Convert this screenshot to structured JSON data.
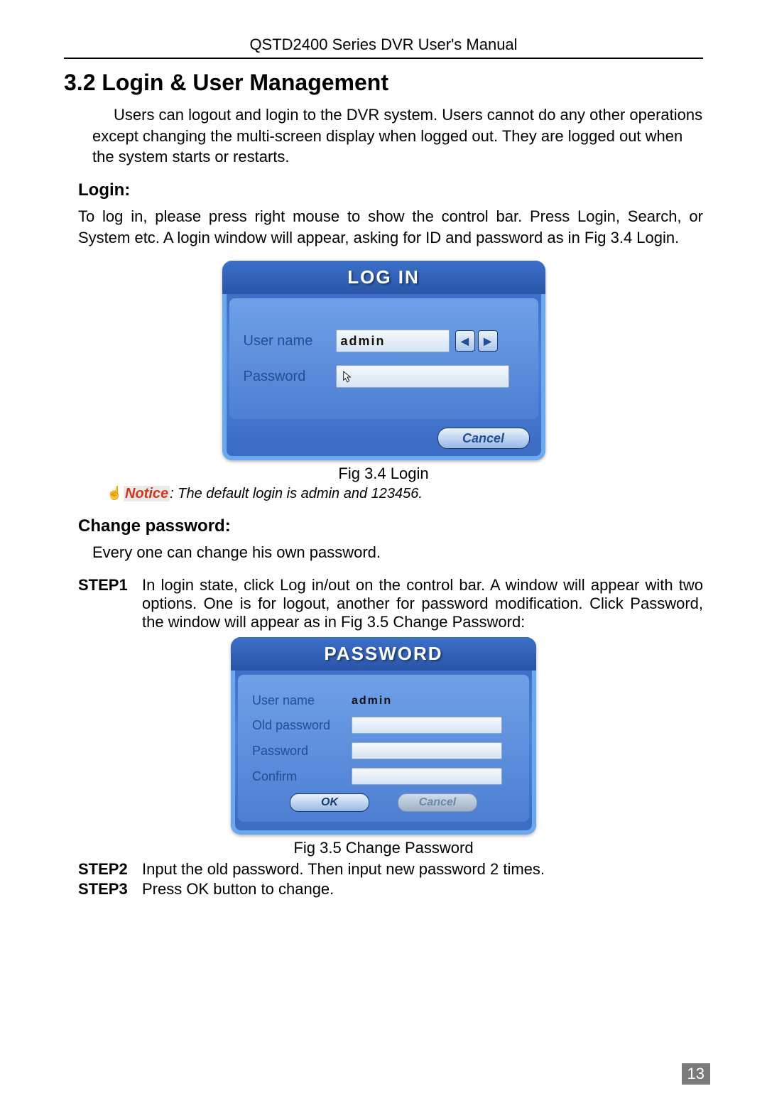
{
  "header": "QSTD2400 Series DVR User's Manual",
  "section_title": "3.2  Login & User Management",
  "intro": "Users can logout and login to the DVR system. Users cannot do any other operations except changing the multi-screen display when logged out. They are logged out when the system starts or restarts.",
  "login": {
    "heading": "Login:",
    "paragraph": "To log in, please press right mouse to show the control bar. Press Login, Search, or System etc. A login window will appear, asking for ID and password as in Fig 3.4 Login.",
    "caption": "Fig 3.4 Login"
  },
  "notice": {
    "label": "Notice",
    "text": ": The default login is admin and 123456."
  },
  "login_dialog": {
    "title": "LOG IN",
    "user_label": "User name",
    "user_value": "admin",
    "pass_label": "Password",
    "pass_value": "",
    "cancel": "Cancel"
  },
  "change_pw": {
    "heading": "Change password:",
    "intro": "Every one can change his own password.",
    "step1_label": "STEP1",
    "step1_text": "In login state, click Log in/out on the control bar. A window will appear with two options. One is for logout, another for password modification. Click Password, the window will appear as in Fig 3.5   Change Password:",
    "caption": "Fig 3.5   Change Password",
    "step2_label": "STEP2",
    "step2_text": "Input the old password. Then input new password 2 times.",
    "step3_label": "STEP3",
    "step3_text": "Press OK button to change."
  },
  "pwd_dialog": {
    "title": "PASSWORD",
    "user_label": "User name",
    "user_value": "admin",
    "old_label": "Old password",
    "new_label": "Password",
    "confirm_label": "Confirm",
    "ok": "OK",
    "cancel": "Cancel"
  },
  "page_number": "13"
}
